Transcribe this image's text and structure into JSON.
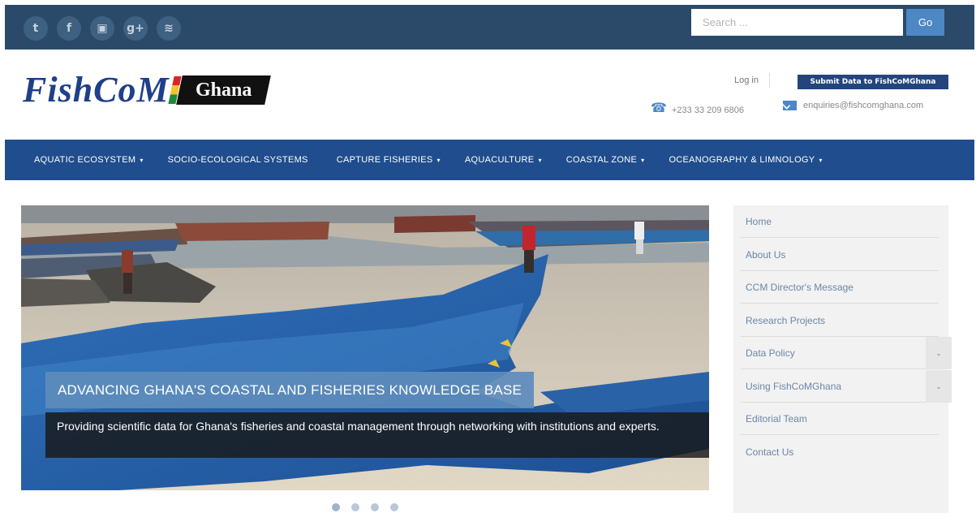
{
  "topbar": {
    "social": [
      {
        "icon": "twitter-icon",
        "glyph": "t"
      },
      {
        "icon": "facebook-icon",
        "glyph": "f"
      },
      {
        "icon": "youtube-icon",
        "glyph": "▣"
      },
      {
        "icon": "googleplus-icon",
        "glyph": "g+"
      },
      {
        "icon": "rss-icon",
        "glyph": "≋"
      }
    ],
    "search_placeholder": "Search ...",
    "search_button": "Go"
  },
  "header": {
    "logo_text": "FishCoM",
    "logo_badge": "Ghana",
    "login": "Log in",
    "submit_button": "Submit Data to FishCoMGhana",
    "phone": "+233 33 209 6806",
    "email": "enquiries@fishcomghana.com"
  },
  "nav": {
    "items": [
      {
        "label": "AQUATIC ECOSYSTEM",
        "caret": "▾"
      },
      {
        "label": "SOCIO-ECOLOGICAL SYSTEMS",
        "caret": ""
      },
      {
        "label": "CAPTURE FISHERIES",
        "caret": "▾"
      },
      {
        "label": "AQUACULTURE",
        "caret": "▾"
      },
      {
        "label": "COASTAL ZONE",
        "caret": "▾"
      },
      {
        "label": "OCEANOGRAPHY & LIMNOLOGY",
        "caret": "▾"
      }
    ]
  },
  "hero": {
    "title": "ADVANCING GHANA'S COASTAL AND FISHERIES KNOWLEDGE BASE",
    "subtitle": "Providing scientific data for Ghana's fisheries and coastal management through networking with institutions and experts.",
    "slide_count": 4,
    "active_slide": 1
  },
  "sidebar": {
    "items": [
      {
        "label": "Home",
        "toggle": ""
      },
      {
        "label": "About Us",
        "toggle": ""
      },
      {
        "label": "CCM Director's Message",
        "toggle": ""
      },
      {
        "label": "Research Projects",
        "toggle": ""
      },
      {
        "label": "Data Policy",
        "toggle": "⌄"
      },
      {
        "label": "Using FishCoMGhana",
        "toggle": "⌄"
      },
      {
        "label": "Editorial Team",
        "toggle": ""
      },
      {
        "label": "Contact Us",
        "toggle": ""
      }
    ]
  },
  "colors": {
    "topbar": "#2b4a69",
    "nav": "#1f4d8d",
    "accent": "#4d87c4",
    "logo": "#1f3f8a"
  }
}
